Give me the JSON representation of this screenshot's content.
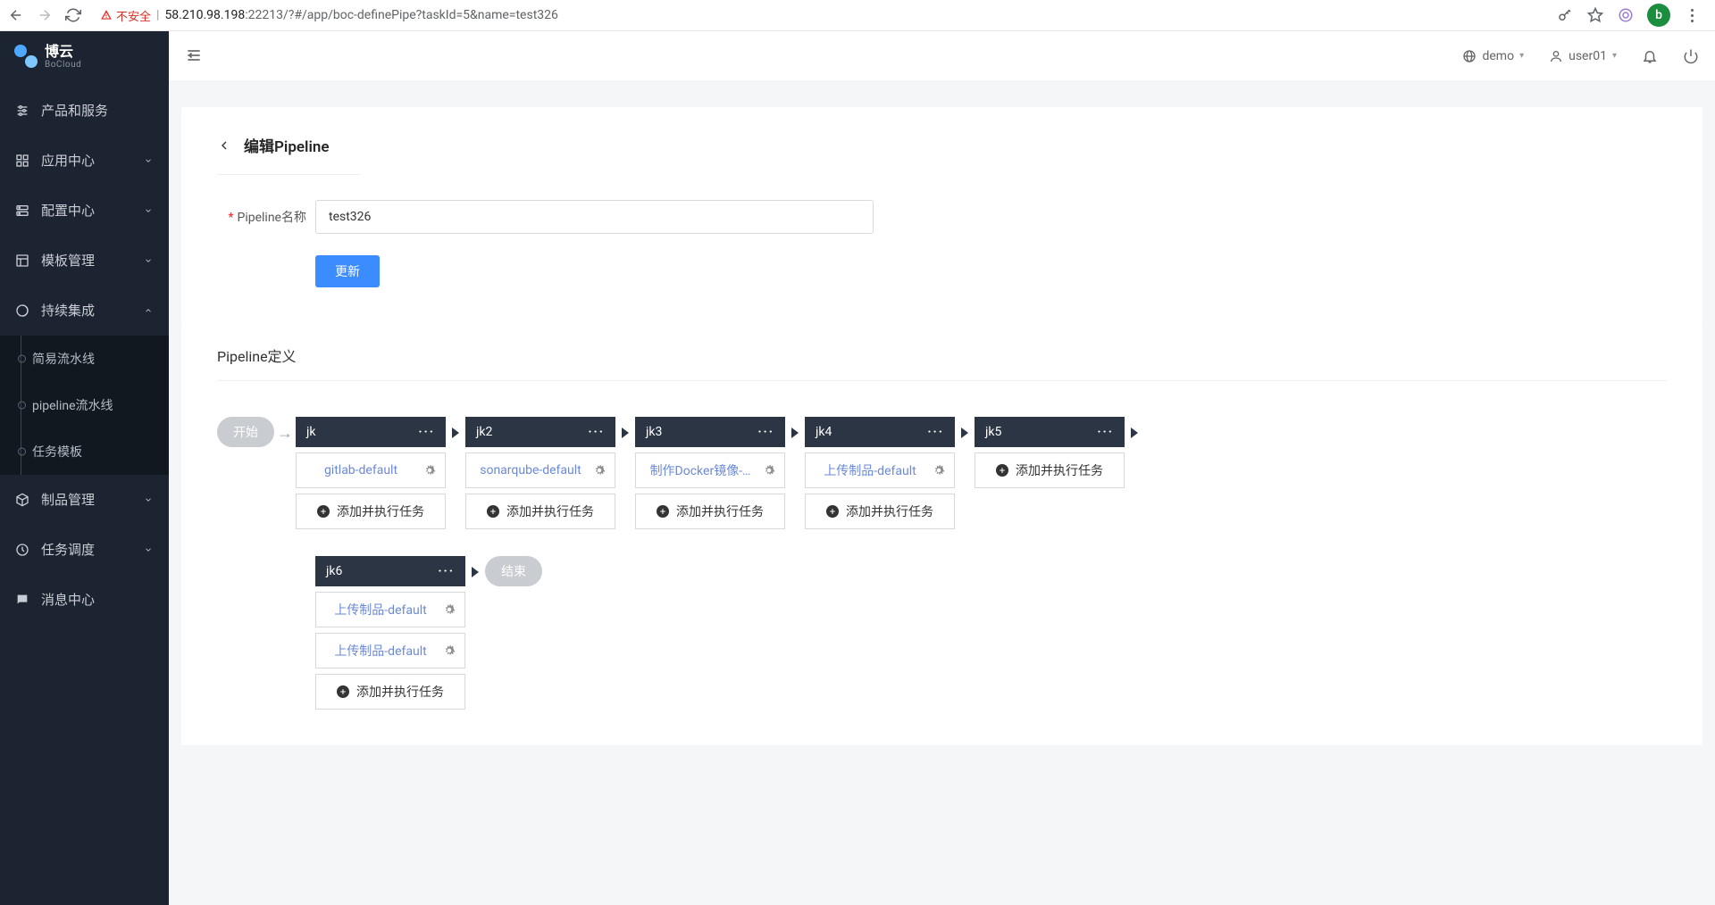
{
  "browser": {
    "insecure_label": "不安全",
    "url_host": "58.210.98.198",
    "url_port": ":22213",
    "url_path": "/?#/app/boc-definePipe?taskId=5&name=test326",
    "avatar_letter": "b"
  },
  "logo": {
    "cn": "博云",
    "en": "BoCloud"
  },
  "sidebar": {
    "items": [
      {
        "label": "产品和服务",
        "expandable": false
      },
      {
        "label": "应用中心",
        "expandable": true
      },
      {
        "label": "配置中心",
        "expandable": true
      },
      {
        "label": "模板管理",
        "expandable": true
      },
      {
        "label": "持续集成",
        "expandable": true,
        "expanded": true
      },
      {
        "label": "制品管理",
        "expandable": true
      },
      {
        "label": "任务调度",
        "expandable": true
      },
      {
        "label": "消息中心",
        "expandable": false
      }
    ],
    "ci_children": [
      {
        "label": "简易流水线"
      },
      {
        "label": "pipeline流水线"
      },
      {
        "label": "任务模板"
      }
    ]
  },
  "topbar": {
    "tenant": "demo",
    "user": "user01"
  },
  "page": {
    "title": "编辑Pipeline",
    "name_label": "Pipeline名称",
    "name_value": "test326",
    "update_btn": "更新",
    "section_title": "Pipeline定义"
  },
  "pipeline": {
    "start_label": "开始",
    "end_label": "结束",
    "add_task_label": "添加并执行任务",
    "stages": [
      {
        "name": "jk",
        "tasks": [
          "gitlab-default"
        ]
      },
      {
        "name": "jk2",
        "tasks": [
          "sonarqube-default"
        ]
      },
      {
        "name": "jk3",
        "tasks": [
          "制作Docker镜像-…"
        ]
      },
      {
        "name": "jk4",
        "tasks": [
          "上传制品-default"
        ]
      },
      {
        "name": "jk5",
        "tasks": []
      },
      {
        "name": "jk6",
        "tasks": [
          "上传制品-default",
          "上传制品-default"
        ]
      }
    ]
  }
}
